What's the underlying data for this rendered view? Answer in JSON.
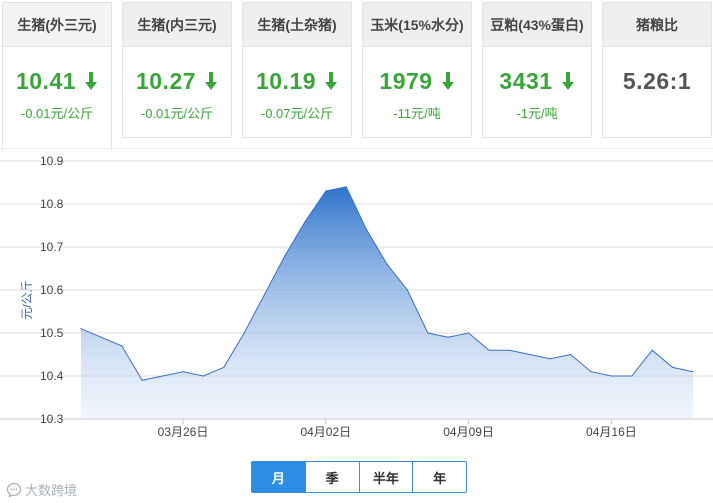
{
  "cards": [
    {
      "title": "生猪(外三元)",
      "value": "10.41",
      "change": "-0.01元/公斤",
      "trend": "down"
    },
    {
      "title": "生猪(内三元)",
      "value": "10.27",
      "change": "-0.01元/公斤",
      "trend": "down"
    },
    {
      "title": "生猪(土杂猪)",
      "value": "10.19",
      "change": "-0.07元/公斤",
      "trend": "down"
    },
    {
      "title": "玉米(15%水分)",
      "value": "1979",
      "change": "-11元/吨",
      "trend": "down"
    },
    {
      "title": "豆粕(43%蛋白)",
      "value": "3431",
      "change": "-1元/吨",
      "trend": "down"
    },
    {
      "title": "猪粮比",
      "value": "5.26:1",
      "change": "",
      "trend": "none"
    }
  ],
  "colors": {
    "down": "#3aa63a",
    "line": "#3a7bd5",
    "accent": "#2b8de3"
  },
  "chart_data": {
    "type": "area",
    "title": "",
    "xlabel": "",
    "ylabel": "元/公斤",
    "ylim": [
      10.3,
      10.9
    ],
    "yticks": [
      "10.3",
      "10.4",
      "10.5",
      "10.6",
      "10.7",
      "10.8",
      "10.9"
    ],
    "xtick_labels": [
      {
        "index": 5,
        "label": "03月26日"
      },
      {
        "index": 12,
        "label": "04月02日"
      },
      {
        "index": 19,
        "label": "04月09日"
      },
      {
        "index": 26,
        "label": "04月16日"
      }
    ],
    "grid": true,
    "series": [
      {
        "values": [
          10.51,
          10.49,
          10.47,
          10.39,
          10.4,
          10.41,
          10.4,
          10.42,
          10.5,
          10.59,
          10.68,
          10.76,
          10.83,
          10.84,
          10.74,
          10.66,
          10.6,
          10.5,
          10.49,
          10.5,
          10.46,
          10.46,
          10.45,
          10.44,
          10.45,
          10.41,
          10.4,
          10.4,
          10.46,
          10.42,
          10.41
        ]
      }
    ]
  },
  "range_buttons": [
    "月",
    "季",
    "半年",
    "年"
  ],
  "active_range": "月",
  "watermark": "大数跨境"
}
